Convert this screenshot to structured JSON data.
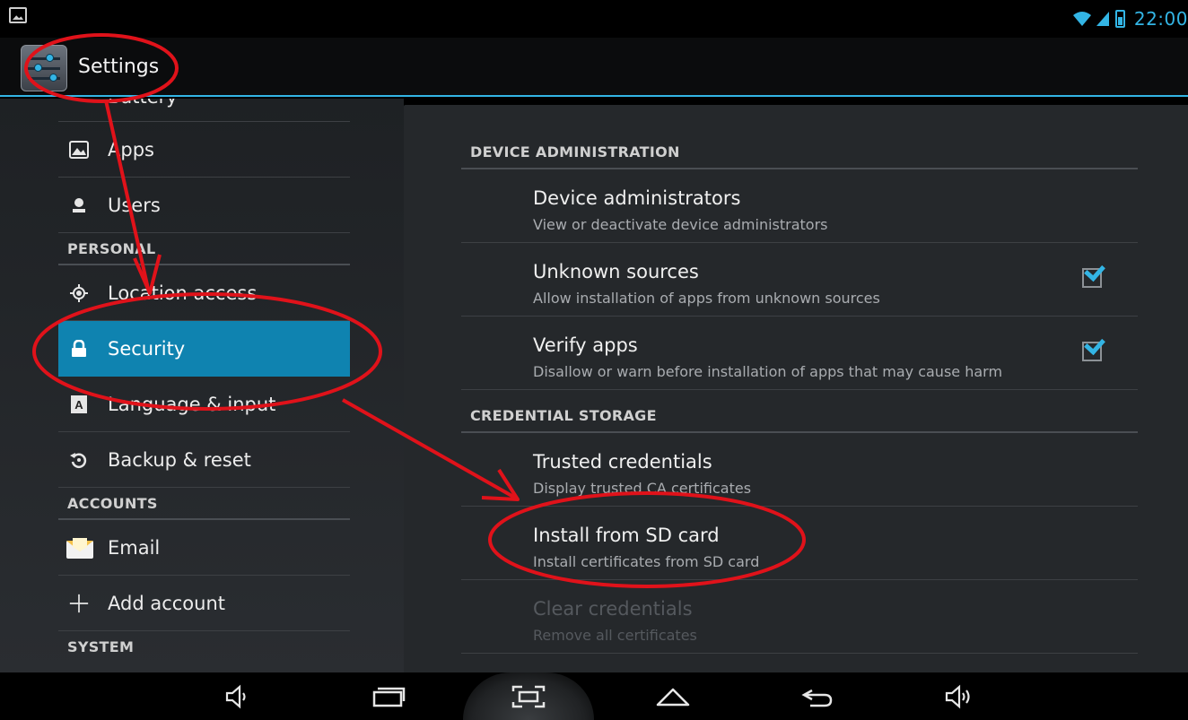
{
  "status_bar": {
    "time": "22:00",
    "icons": [
      "gallery-icon",
      "wifi-icon",
      "signal-icon",
      "battery-icon"
    ],
    "accent": "#33b5e5"
  },
  "action_bar": {
    "title": "Settings",
    "icon": "settings-app-icon"
  },
  "left_nav": {
    "cut_item_label": "Battery",
    "items_top": [
      {
        "label": "Apps",
        "icon": "apps-icon"
      },
      {
        "label": "Users",
        "icon": "users-icon"
      }
    ],
    "personal_header": "PERSONAL",
    "personal_items": [
      {
        "label": "Location access",
        "icon": "location-icon"
      },
      {
        "label": "Security",
        "icon": "lock-icon",
        "selected": true
      },
      {
        "label": "Language & input",
        "icon": "keyboard-icon"
      },
      {
        "label": "Backup & reset",
        "icon": "backup-icon"
      }
    ],
    "accounts_header": "ACCOUNTS",
    "account_items": [
      {
        "label": "Email",
        "icon": "email-icon"
      },
      {
        "label": "Add account",
        "icon": "plus-icon"
      }
    ],
    "system_header": "SYSTEM",
    "selected_color": "#0f83b0"
  },
  "security_pane": {
    "device_admin_header": "DEVICE ADMINISTRATION",
    "device_admin_items": [
      {
        "title": "Device administrators",
        "summary": "View or deactivate device administrators",
        "checkbox": false
      },
      {
        "title": "Unknown sources",
        "summary": "Allow installation of apps from unknown sources",
        "checkbox": true,
        "checked": true
      },
      {
        "title": "Verify apps",
        "summary": "Disallow or warn before installation of apps that may cause harm",
        "checkbox": true,
        "checked": true
      }
    ],
    "credential_header": "CREDENTIAL STORAGE",
    "credential_items": [
      {
        "title": "Trusted credentials",
        "summary": "Display trusted CA certificates",
        "enabled": true
      },
      {
        "title": "Install from SD card",
        "summary": "Install certificates from SD card",
        "enabled": true
      },
      {
        "title": "Clear credentials",
        "summary": "Remove all certificates",
        "enabled": false
      }
    ]
  },
  "nav_bar": {
    "buttons": [
      "volume-down-icon",
      "recent-apps-icon",
      "screenshot-icon",
      "home-icon",
      "back-icon",
      "volume-up-icon"
    ]
  },
  "annotations": {
    "color": "#e0121a",
    "description_targets": [
      "Settings",
      "Security",
      "Install from SD card"
    ]
  }
}
